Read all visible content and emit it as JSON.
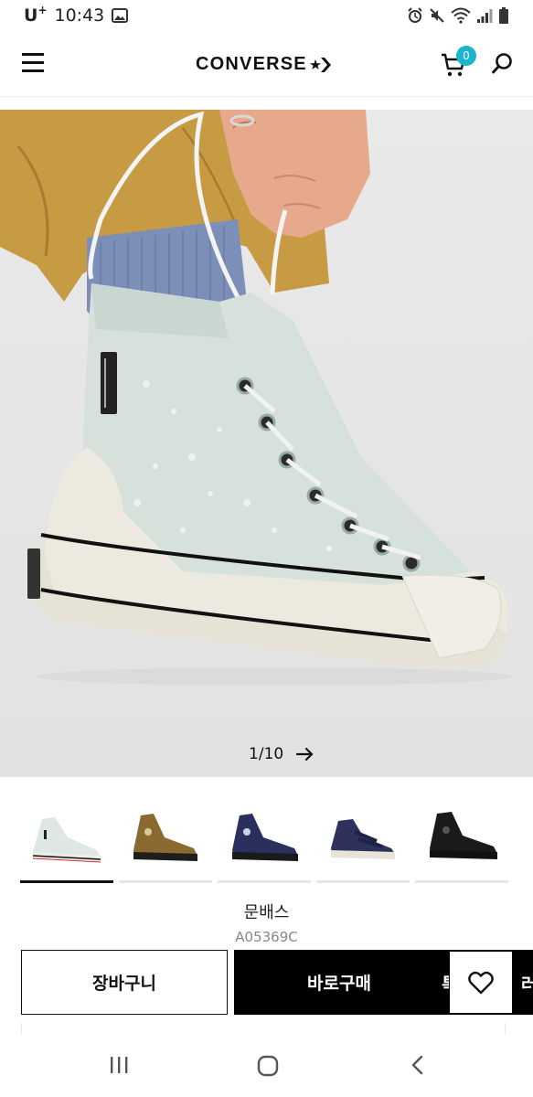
{
  "status_bar": {
    "carrier": "U",
    "carrier_sup": "+",
    "time": "10:43",
    "icons": [
      "image-icon",
      "alarm-icon",
      "mute-icon",
      "wifi-icon",
      "signal-icon",
      "battery-icon"
    ]
  },
  "header": {
    "logo": "CONVERSE",
    "cart_count": "0",
    "icons": [
      "menu-icon",
      "cart-icon",
      "search-icon"
    ]
  },
  "gallery": {
    "page_current": "1",
    "page_separator": "/",
    "page_total": "10",
    "selected_index": 0,
    "thumbnails": [
      {
        "colorway": "light blue / cream",
        "color": "#dfe6e6"
      },
      {
        "colorway": "wheat brown",
        "color": "#8a6a2e"
      },
      {
        "colorway": "navy",
        "color": "#2b2f5e"
      },
      {
        "colorway": "navy velcro",
        "color": "#2d315c"
      },
      {
        "colorway": "black",
        "color": "#1a1a1a"
      }
    ]
  },
  "product": {
    "color_name": "문배스",
    "sku": "A05369C"
  },
  "actions": {
    "add_to_cart": "장바구니",
    "buy_now": "바로구매",
    "overflow_left": "톡",
    "overflow_right": "러",
    "wishlist_icon": "heart-icon"
  },
  "navbar": {
    "icons": [
      "recent-apps-icon",
      "home-icon",
      "back-icon"
    ]
  },
  "colors": {
    "accent_badge": "#1bb5d0",
    "primary_button": "#000000"
  }
}
